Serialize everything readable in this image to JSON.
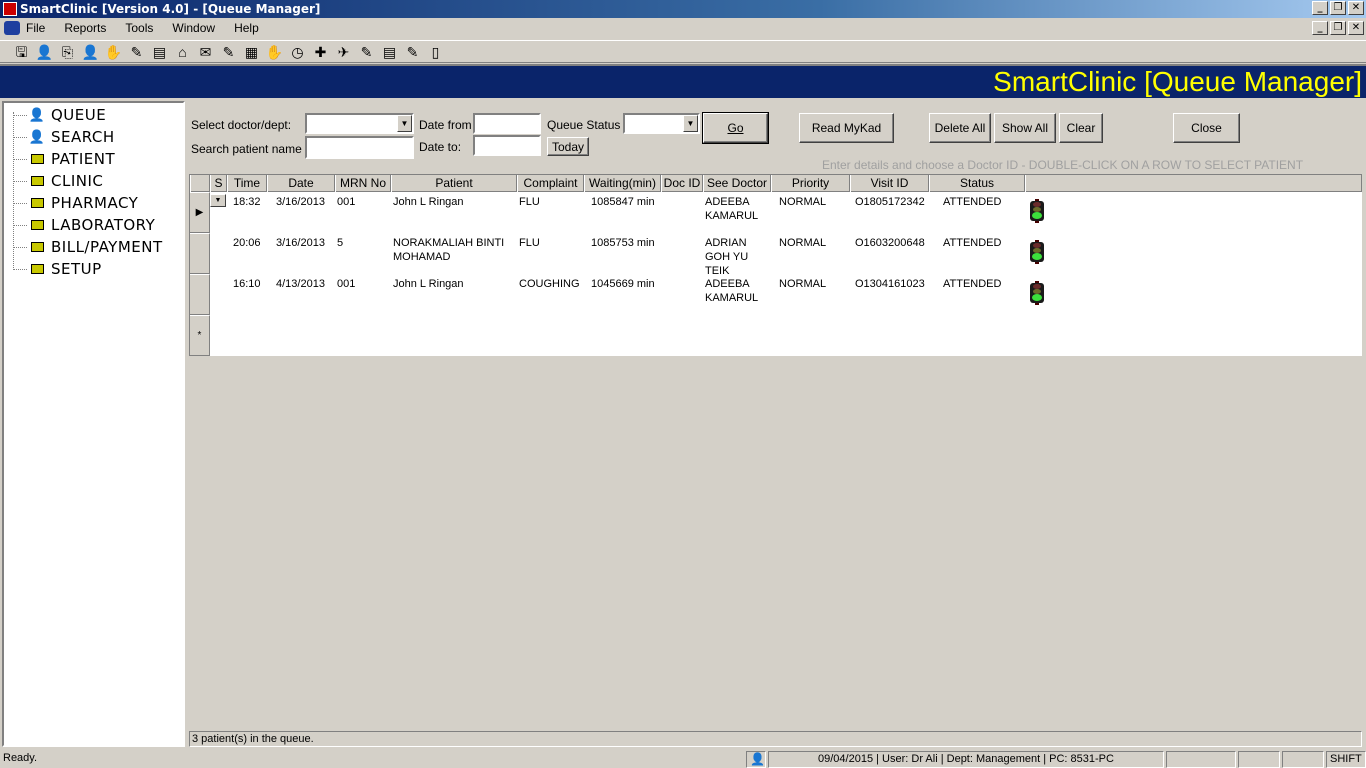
{
  "window": {
    "title": "SmartClinic [Version 4.0] - [Queue Manager]",
    "controls": [
      "_",
      "❐",
      "✕"
    ]
  },
  "menu": [
    "File",
    "Reports",
    "Tools",
    "Window",
    "Help"
  ],
  "toolbar": {
    "icons": [
      "toolbar-icon-1",
      "toolbar-icon-2",
      "toolbar-icon-3",
      "toolbar-icon-4",
      "toolbar-icon-5",
      "toolbar-icon-6",
      "toolbar-icon-7",
      "toolbar-icon-8",
      "toolbar-icon-9",
      "toolbar-icon-10",
      "toolbar-icon-11",
      "toolbar-icon-12",
      "toolbar-icon-13",
      "toolbar-icon-14",
      "toolbar-icon-15",
      "toolbar-icon-16",
      "toolbar-icon-17",
      "toolbar-icon-18",
      "toolbar-icon-19"
    ]
  },
  "header": {
    "title": "SmartClinic [Queue Manager]"
  },
  "sidebar": {
    "items": [
      {
        "label": "QUEUE",
        "icon": "person-icon"
      },
      {
        "label": "SEARCH",
        "icon": "person-icon"
      },
      {
        "label": "PATIENT",
        "icon": "folder-icon"
      },
      {
        "label": "CLINIC",
        "icon": "folder-icon"
      },
      {
        "label": "PHARMACY",
        "icon": "folder-icon"
      },
      {
        "label": "LABORATORY",
        "icon": "folder-icon"
      },
      {
        "label": "BILL/PAYMENT",
        "icon": "folder-icon"
      },
      {
        "label": "SETUP",
        "icon": "folder-icon"
      }
    ]
  },
  "filters": {
    "doctor_label": "Select doctor/dept:",
    "doctor_value": "",
    "search_label": "Search patient name",
    "search_value": "",
    "date_from_label": "Date from",
    "date_from_value": "",
    "date_to_label": "Date to:",
    "date_to_value": "",
    "queue_status_label": "Queue Status",
    "queue_status_value": "",
    "today_label": "Today",
    "go_label": "Go",
    "read_mykad_label": "Read MyKad",
    "delete_all_label": "Delete All",
    "show_all_label": "Show All",
    "clear_label": "Clear",
    "close_label": "Close",
    "hint": "Enter details and choose a Doctor ID - DOUBLE-CLICK  ON A ROW TO SELECT PATIENT"
  },
  "grid": {
    "columns": [
      "S",
      "Time",
      "Date",
      "MRN No",
      "Patient",
      "Complaint",
      "Waiting(min)",
      "Doc ID",
      "See Doctor",
      "Priority",
      "Visit ID",
      "Status",
      ""
    ],
    "rows": [
      {
        "time": "18:32",
        "date": "3/16/2013",
        "mrn": "001",
        "patient": "John L Ringan",
        "complaint": "FLU",
        "waiting": "1085847 min",
        "doc_id": "",
        "see_doctor": "ADEEBA KAMARUL",
        "priority": "NORMAL",
        "visit_id": "O1805172342",
        "status": "ATTENDED",
        "light": "green"
      },
      {
        "time": "20:06",
        "date": "3/16/2013",
        "mrn": "5",
        "patient": "NORAKMALIAH BINTI MOHAMAD",
        "complaint": "FLU",
        "waiting": "1085753 min",
        "doc_id": "",
        "see_doctor": "ADRIAN GOH YU TEIK",
        "priority": "NORMAL",
        "visit_id": "O1603200648",
        "status": "ATTENDED",
        "light": "green"
      },
      {
        "time": "16:10",
        "date": "4/13/2013",
        "mrn": "001",
        "patient": "John L Ringan",
        "complaint": "COUGHING",
        "waiting": "1045669 min",
        "doc_id": "",
        "see_doctor": "ADEEBA KAMARUL",
        "priority": "NORMAL",
        "visit_id": "O1304161023",
        "status": "ATTENDED",
        "light": "green"
      }
    ],
    "new_row_marker": "*",
    "count_text": "3 patient(s) in the queue."
  },
  "statusbar": {
    "ready": "Ready.",
    "info": "09/04/2015 | User: Dr Ali | Dept: Management | PC: 8531-PC",
    "shift": "SHIFT"
  }
}
